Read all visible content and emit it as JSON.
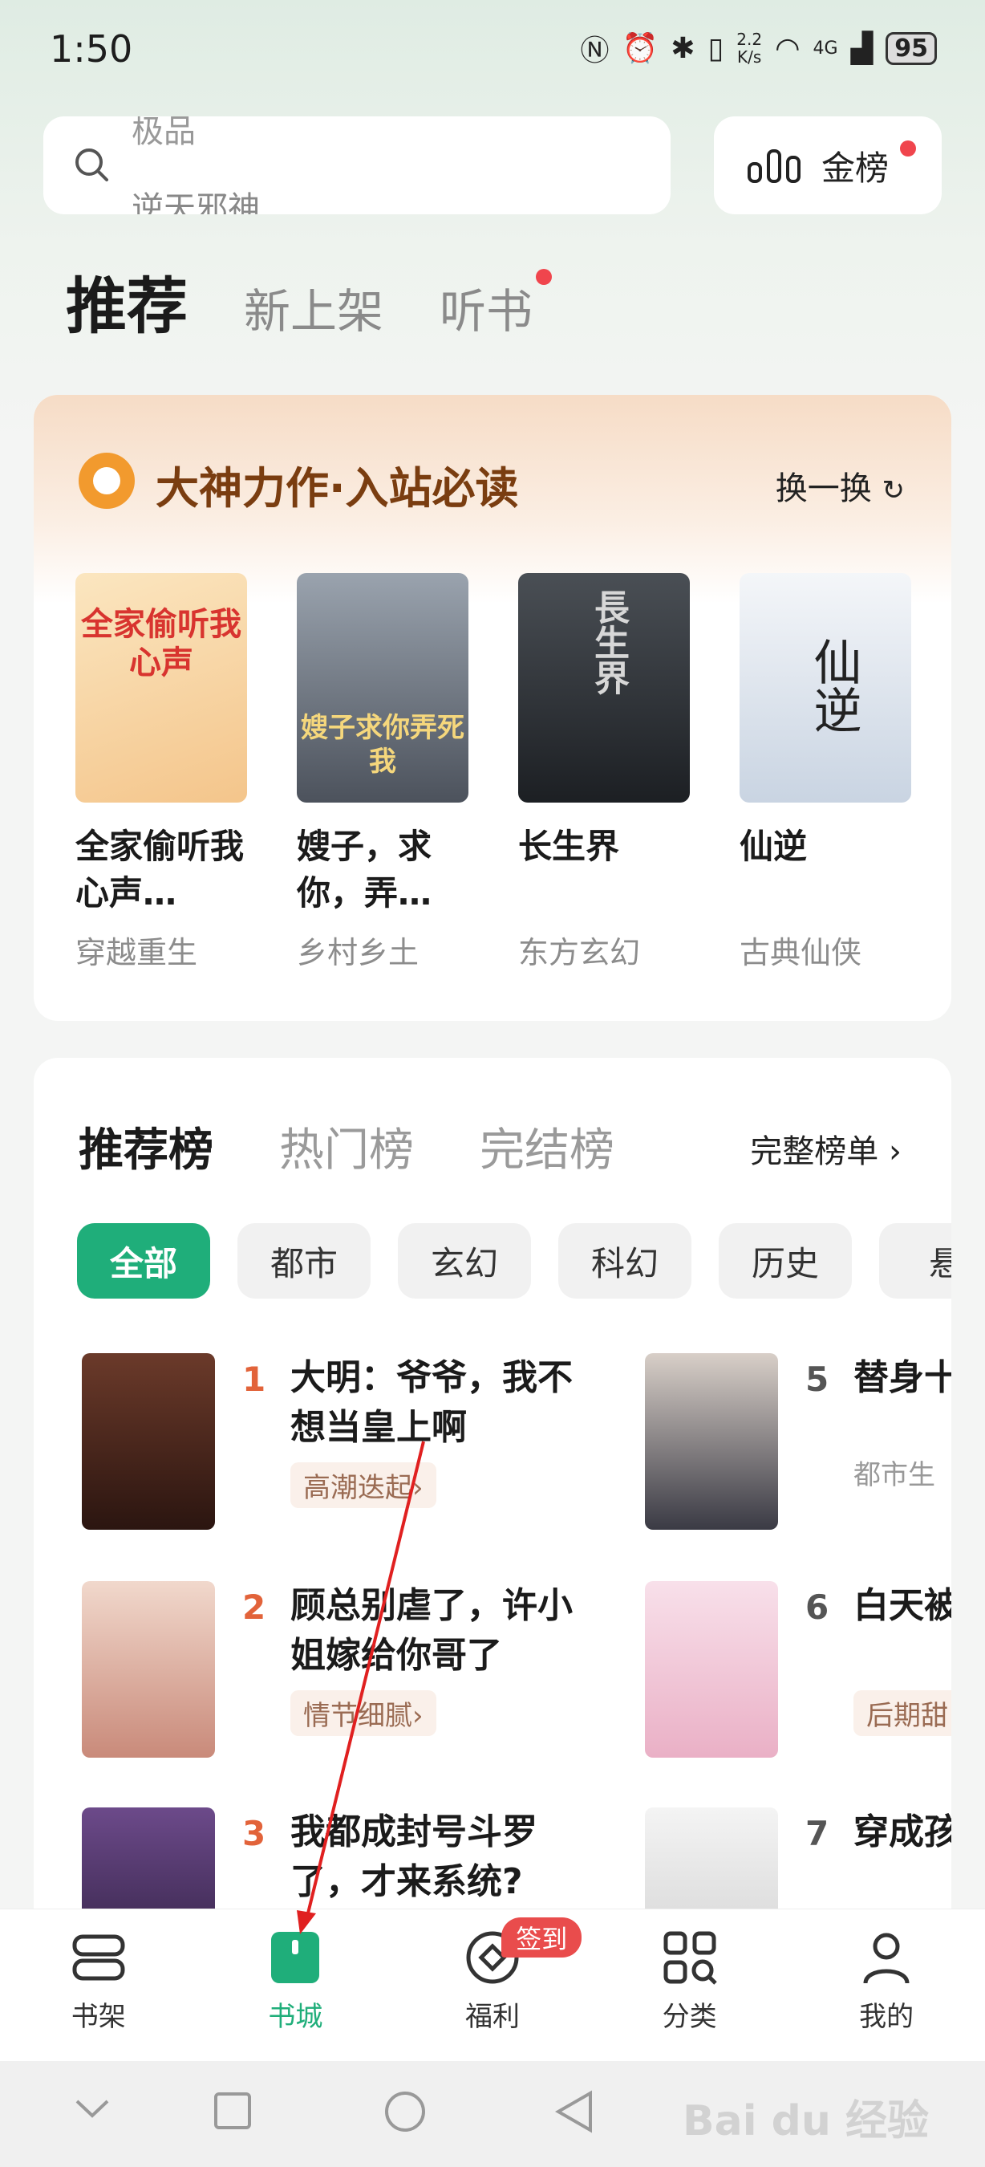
{
  "status_bar": {
    "time": "1:50",
    "speed_value": "2.2",
    "speed_unit": "K/s",
    "network": "4G",
    "battery": "95"
  },
  "search": {
    "hint_top": "极品",
    "hint_main": "逆天邪神"
  },
  "gold_list": {
    "label": "金榜"
  },
  "main_tabs": [
    "推荐",
    "新上架",
    "听书"
  ],
  "featured": {
    "title": "大神力作·入站必读",
    "refresh_label": "换一换",
    "books": [
      {
        "title": "全家偷听我心声…",
        "category": "穿越重生",
        "cover_text": "全家偷听我心声",
        "cover_color": "#f6d9a6"
      },
      {
        "title": "嫂子，求你，弄…",
        "category": "乡村乡土",
        "cover_text": "嫂子求你弄死我",
        "cover_color": "#6d7480"
      },
      {
        "title": "长生界",
        "category": "东方玄幻",
        "cover_text": "長生界",
        "cover_color": "#2f3338"
      },
      {
        "title": "仙逆",
        "category": "古典仙侠",
        "cover_text": "仙逆",
        "cover_color": "#e4eaf1"
      }
    ]
  },
  "ranking": {
    "tabs": [
      "推荐榜",
      "热门榜",
      "完结榜"
    ],
    "full_list_label": "完整榜单",
    "chips": [
      "全部",
      "都市",
      "玄幻",
      "科幻",
      "历史",
      "悬"
    ],
    "items_left": [
      {
        "rank": "1",
        "title": "大明：爷爷，我不想当皇上啊",
        "tag": "高潮迭起",
        "cover_color": "#5b3426"
      },
      {
        "rank": "2",
        "title": "顾总别虐了，许小姐嫁给你哥了",
        "tag": "情节细腻",
        "cover_color": "#d9a79a"
      },
      {
        "rank": "3",
        "title": "我都成封号斗罗了，才来系统?",
        "tag": "",
        "cover_color": "#4a3560"
      }
    ],
    "items_right": [
      {
        "rank": "5",
        "title": "替身十年去，她",
        "tag": "都市生",
        "cover_color": "#3a3a44"
      },
      {
        "rank": "6",
        "title": "白天被奶凶指",
        "tag": "后期甜",
        "cover_color": "#f2c6d8"
      },
      {
        "rank": "7",
        "title": "穿成孩成赢家",
        "tag": "",
        "cover_color": "#ececec"
      }
    ]
  },
  "bottom_nav": [
    {
      "label": "书架",
      "icon": "bookshelf-icon"
    },
    {
      "label": "书城",
      "icon": "bookstore-icon"
    },
    {
      "label": "福利",
      "icon": "welfare-icon"
    },
    {
      "label": "分类",
      "icon": "category-icon"
    },
    {
      "label": "我的",
      "icon": "profile-icon"
    }
  ],
  "sign_badge": "签到",
  "watermark": "Bai du 经验",
  "colors": {
    "accent": "#1fae7a",
    "rank_number": "#e2633a",
    "red_dot": "#f0454d"
  }
}
